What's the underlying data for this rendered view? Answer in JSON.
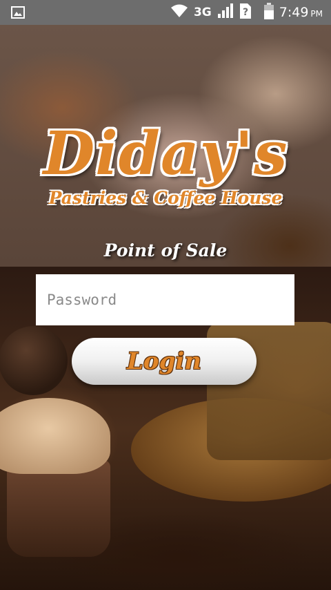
{
  "status_bar": {
    "network": "3G",
    "time": "7:49",
    "ampm": "PM",
    "icons": [
      "gallery-icon",
      "wifi-icon",
      "signal-icon",
      "sim-unknown-icon",
      "battery-icon"
    ]
  },
  "logo": {
    "name": "Diday's",
    "tagline": "Pastries & Coffee House"
  },
  "subtitle": "Point of Sale",
  "form": {
    "password_placeholder": "Password",
    "login_label": "Login"
  },
  "colors": {
    "brand_orange": "#e0862a",
    "status_bar": "#6d6d6d"
  }
}
